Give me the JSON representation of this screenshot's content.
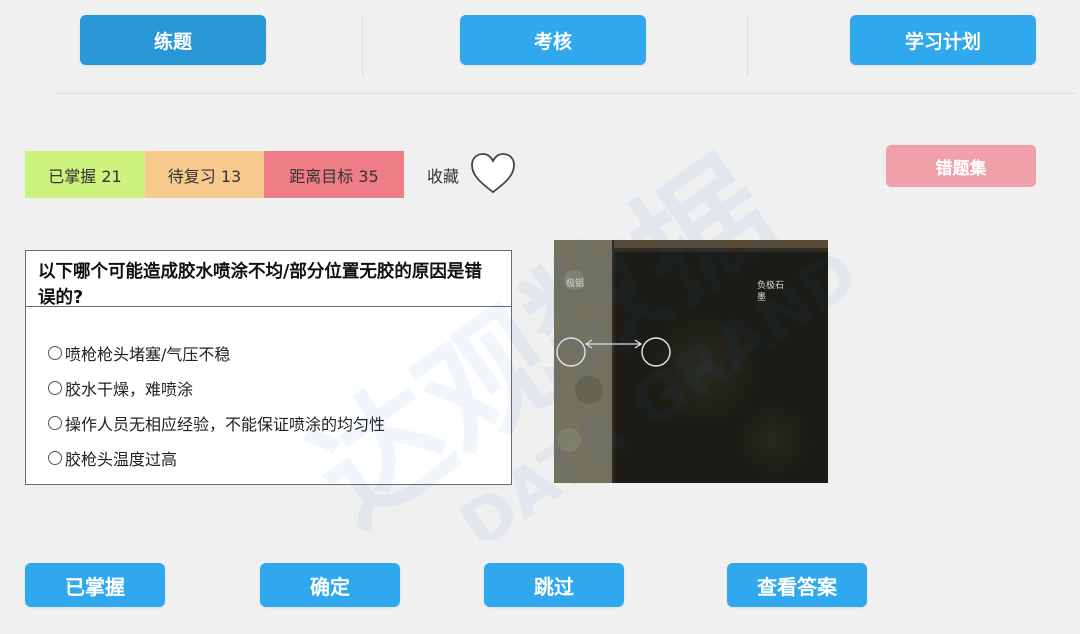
{
  "tabs": {
    "practice": "练题",
    "exam": "考核",
    "plan": "学习计划"
  },
  "stats": {
    "mastered": "已掌握 21",
    "review": "待复习 13",
    "target": "距离目标 35",
    "colors": {
      "mastered": "#cdf27e",
      "review": "#f8c98c",
      "target": "#ef7d88"
    }
  },
  "favorite": {
    "label": "收藏",
    "icon": "heart-outline-icon"
  },
  "wrong_set": "错题集",
  "question": {
    "title": "以下哪个可能造成胶水喷涂不均/部分位置无胶的原因是错误的?",
    "options": [
      "喷枪枪头堵塞/气压不稳",
      "胶水干燥，难喷涂",
      "操作人员无相应经验，不能保证喷涂的均匀性",
      "胶枪头温度过高"
    ]
  },
  "image": {
    "left_label": "极铝",
    "right_label": "负极石墨"
  },
  "actions": {
    "mastered": "已掌握",
    "confirm": "确定",
    "skip": "跳过",
    "show_answer": "查看答案"
  },
  "watermark": {
    "cn": "达观数据",
    "en": "DATA GRAND"
  },
  "accent": "#2fa8ee"
}
